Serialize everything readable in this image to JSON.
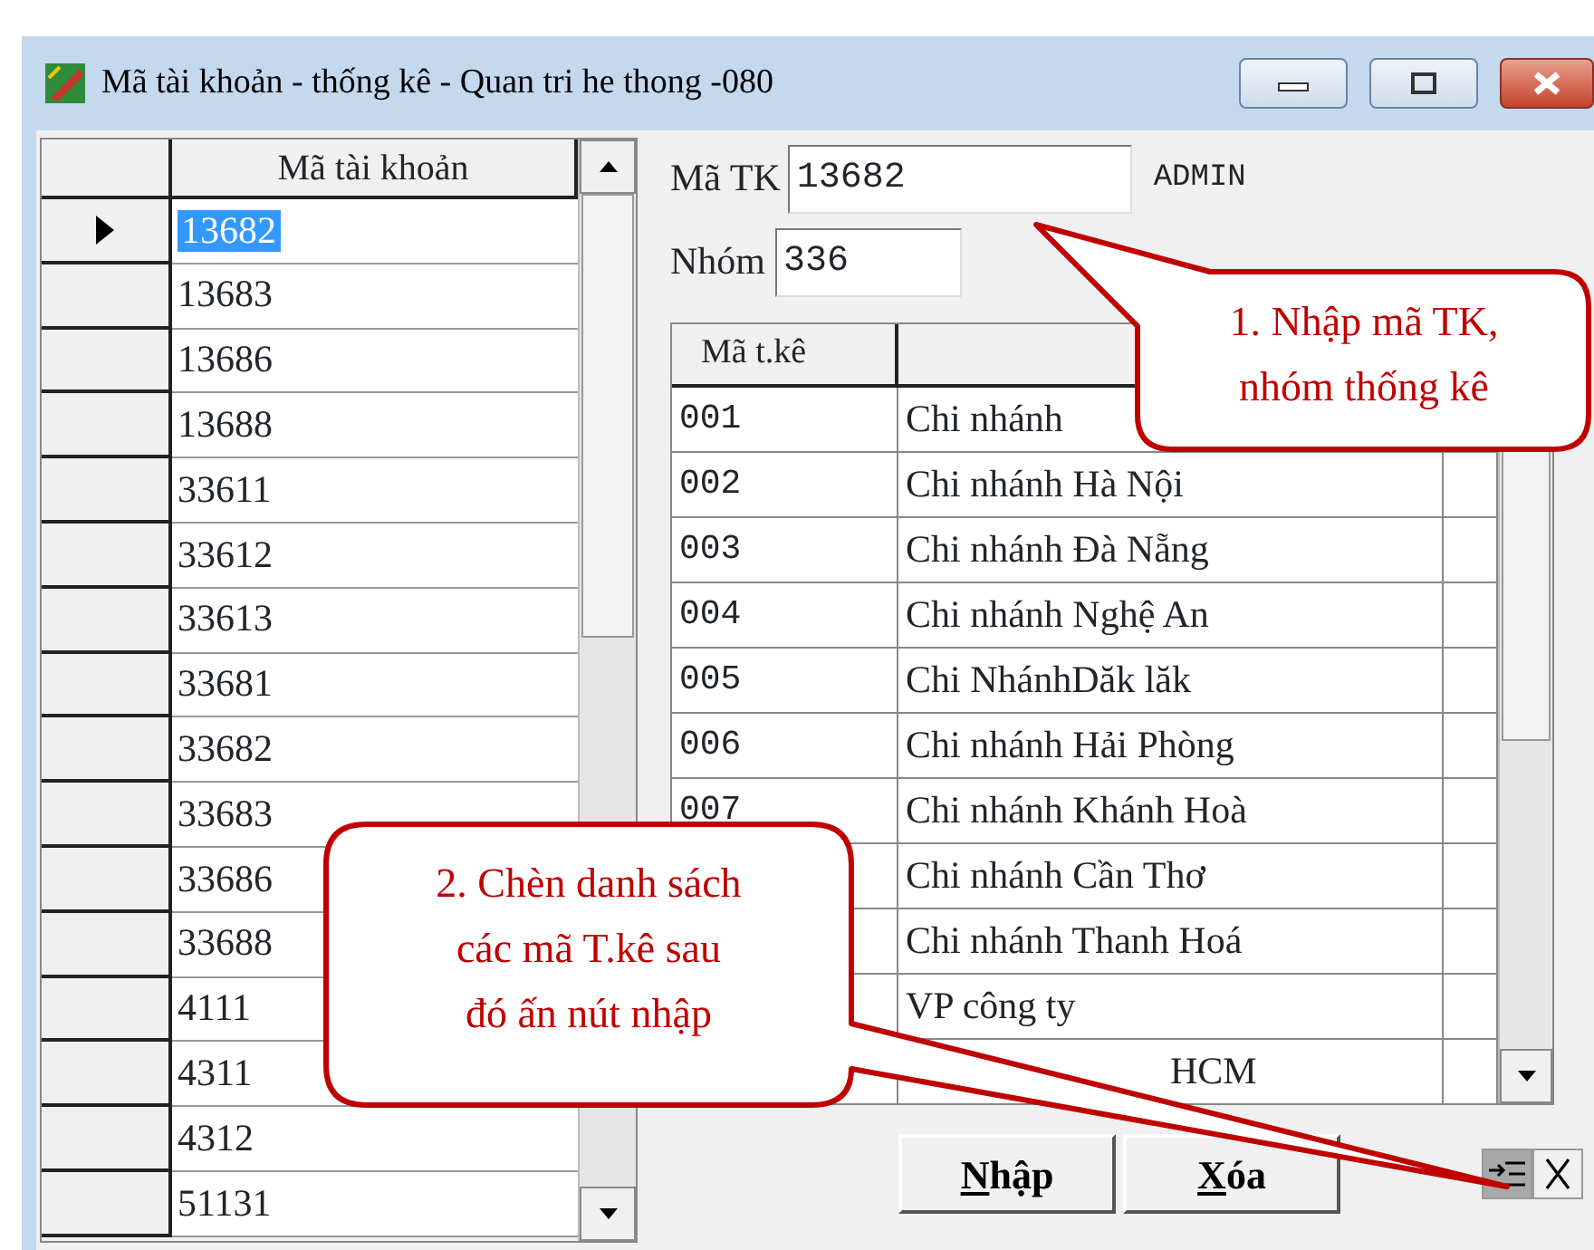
{
  "window": {
    "title": "Mã tài khoản - thống kê - Quan tri he thong -080"
  },
  "account_list": {
    "header": "Mã tài khoản",
    "rows": [
      {
        "code": "13682",
        "selected": true
      },
      {
        "code": "13683",
        "selected": false
      },
      {
        "code": "13686",
        "selected": false
      },
      {
        "code": "13688",
        "selected": false
      },
      {
        "code": "33611",
        "selected": false
      },
      {
        "code": "33612",
        "selected": false
      },
      {
        "code": "33613",
        "selected": false
      },
      {
        "code": "33681",
        "selected": false
      },
      {
        "code": "33682",
        "selected": false
      },
      {
        "code": "33683",
        "selected": false
      },
      {
        "code": "33686",
        "selected": false
      },
      {
        "code": "33688",
        "selected": false
      },
      {
        "code": "4111",
        "selected": false
      },
      {
        "code": "4311",
        "selected": false
      },
      {
        "code": "4312",
        "selected": false
      },
      {
        "code": "51131",
        "selected": false
      }
    ]
  },
  "form": {
    "account_label": "Mã TK",
    "account_value": "13682",
    "user": "ADMIN",
    "group_label": "Nhóm",
    "group_value": "336"
  },
  "stats_table": {
    "columns": [
      "Mã t.kê"
    ],
    "rows": [
      {
        "code": "001",
        "name": "Chi nhánh"
      },
      {
        "code": "002",
        "name": "Chi nhánh Hà Nội"
      },
      {
        "code": "003",
        "name": "Chi nhánh Đà Nẵng"
      },
      {
        "code": "004",
        "name": "Chi nhánh Nghệ An"
      },
      {
        "code": "005",
        "name": "Chi NhánhDăk lăk"
      },
      {
        "code": "006",
        "name": "Chi nhánh Hải Phòng"
      },
      {
        "code": "007",
        "name": "Chi nhánh Khánh Hoà"
      },
      {
        "name": "Chi nhánh Cần Thơ"
      },
      {
        "name": "Chi nhánh Thanh Hoá"
      },
      {
        "name": "VP công ty"
      },
      {
        "name": "HCM",
        "covered": true
      }
    ]
  },
  "buttons": [
    {
      "label": "Nhập"
    },
    {
      "label": "Xóa"
    }
  ],
  "tool_buttons": [
    {
      "kind": "insert",
      "selected": true
    },
    {
      "kind": "delete",
      "selected": false
    }
  ],
  "callouts": [
    {
      "lines": [
        "1. Nhập mã TK,",
        "nhóm thống kê"
      ]
    },
    {
      "lines": [
        "2. Chèn danh sách",
        "các mã T.kê sau",
        "đó ấn nút nhập"
      ]
    }
  ]
}
